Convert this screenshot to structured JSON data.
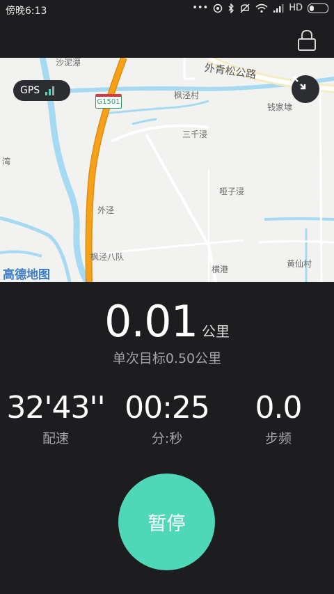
{
  "status_bar": {
    "time": "傍晚6:13",
    "dots": "•••",
    "hd": "HD"
  },
  "map": {
    "gps_label": "GPS",
    "road_shield": "G1501",
    "labels": [
      "沙泥潭",
      "外青松公路",
      "枫泾村",
      "钱家埭",
      "三千浸",
      "湾",
      "哑子浸",
      "外泾",
      "枫泾八队",
      "横港",
      "黄仙村"
    ],
    "logo": "高德地图",
    "colors": {
      "highway": "#f5a21a",
      "water": "#a6d9f2",
      "road": "#ffffff"
    }
  },
  "workout": {
    "distance": "0.01",
    "distance_unit": "公里",
    "goal": "单次目标0.50公里",
    "stats": [
      {
        "value": "32'43''",
        "label": "配速"
      },
      {
        "value": "00:25",
        "label": "分:秒"
      },
      {
        "value": "0.0",
        "label": "步频"
      }
    ]
  },
  "controls": {
    "pause_label": "暂停",
    "accent": "#4fd8b8"
  }
}
